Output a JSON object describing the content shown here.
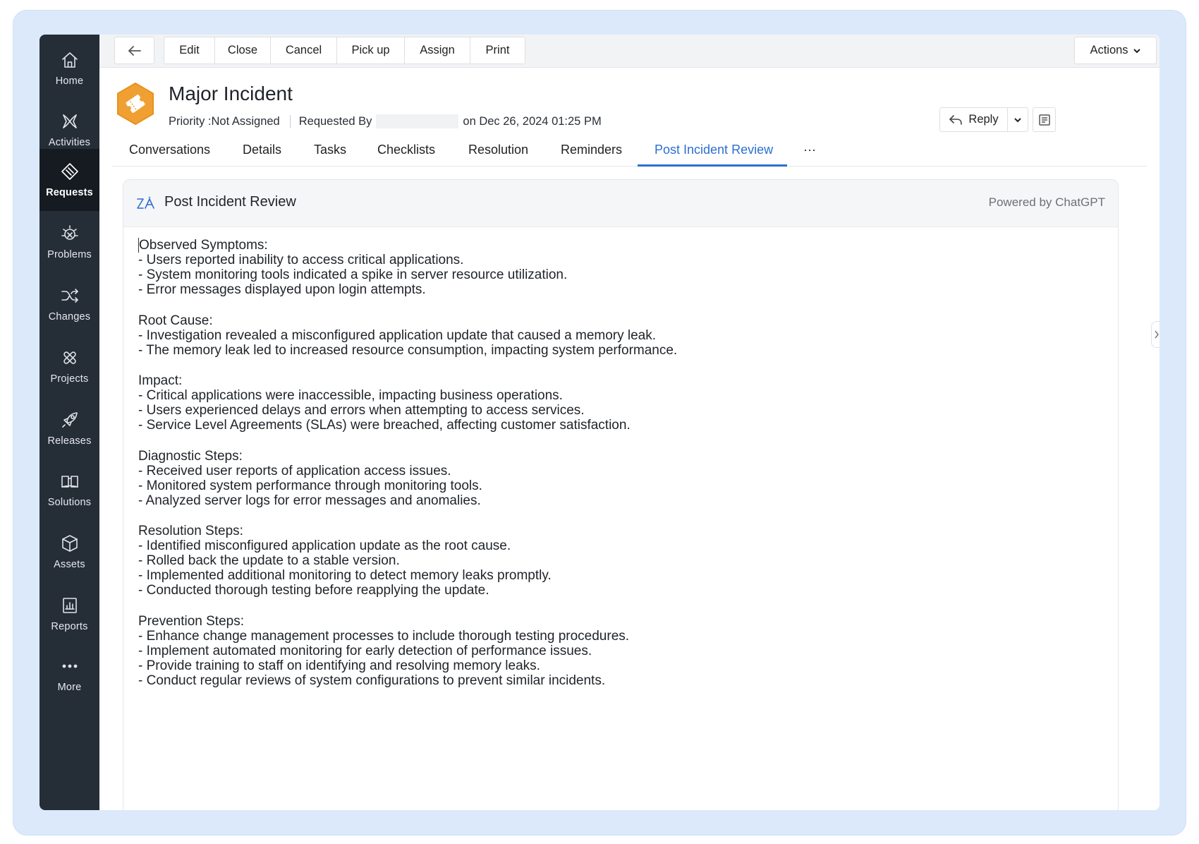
{
  "sidebar": {
    "items": [
      {
        "label": "Home",
        "icon": "home-icon"
      },
      {
        "label": "Activities",
        "icon": "activities-icon"
      },
      {
        "label": "Requests",
        "icon": "requests-icon"
      },
      {
        "label": "Problems",
        "icon": "problems-icon"
      },
      {
        "label": "Changes",
        "icon": "changes-icon"
      },
      {
        "label": "Projects",
        "icon": "projects-icon"
      },
      {
        "label": "Releases",
        "icon": "releases-icon"
      },
      {
        "label": "Solutions",
        "icon": "solutions-icon"
      },
      {
        "label": "Assets",
        "icon": "assets-icon"
      },
      {
        "label": "Reports",
        "icon": "reports-icon"
      },
      {
        "label": "More",
        "icon": "more-icon"
      }
    ],
    "active": "Requests"
  },
  "toolbar": {
    "buttons": [
      "Edit",
      "Close",
      "Cancel",
      "Pick up",
      "Assign",
      "Print"
    ],
    "actions_label": "Actions"
  },
  "request": {
    "title": "Major Incident",
    "priority": "Priority :Not Assigned",
    "requested_by_label": "Requested By",
    "date_text": "on Dec 26, 2024 01:25 PM",
    "reply_label": "Reply"
  },
  "tabs": {
    "items": [
      "Conversations",
      "Details",
      "Tasks",
      "Checklists",
      "Resolution",
      "Reminders",
      "Post Incident Review",
      "···"
    ],
    "active": "Post Incident Review"
  },
  "review": {
    "title": "Post Incident Review",
    "powered_by": "Powered by ChatGPT",
    "sections": [
      {
        "heading": "Observed Symptoms:",
        "lines": [
          "- Users reported inability to access critical applications.",
          "- System monitoring tools indicated a spike in server resource utilization.",
          "- Error messages displayed upon login attempts."
        ]
      },
      {
        "heading": "Root Cause:",
        "lines": [
          "- Investigation revealed a misconfigured application update that caused a memory leak.",
          "- The memory leak led to increased resource consumption, impacting system performance."
        ]
      },
      {
        "heading": "Impact:",
        "lines": [
          "- Critical applications were inaccessible, impacting business operations.",
          "- Users experienced delays and errors when attempting to access services.",
          "- Service Level Agreements (SLAs) were breached, affecting customer satisfaction."
        ]
      },
      {
        "heading": "Diagnostic Steps:",
        "lines": [
          "- Received user reports of application access issues.",
          "- Monitored system performance through monitoring tools.",
          "- Analyzed server logs for error messages and anomalies."
        ]
      },
      {
        "heading": "Resolution Steps:",
        "lines": [
          "- Identified misconfigured application update as the root cause.",
          "- Rolled back the update to a stable version.",
          "- Implemented additional monitoring to detect memory leaks promptly.",
          "- Conducted thorough testing before reapplying the update."
        ]
      },
      {
        "heading": "Prevention Steps:",
        "lines": [
          "- Enhance change management processes to include thorough testing procedures.",
          "- Implement automated monitoring for early detection of performance issues.",
          "- Provide training to staff on identifying and resolving memory leaks.",
          "- Conduct regular reviews of system configurations to prevent similar incidents."
        ]
      }
    ]
  },
  "colors": {
    "accent": "#2b6fd1",
    "sidebar_bg": "#252d37",
    "incident_icon": "#f0a033"
  }
}
